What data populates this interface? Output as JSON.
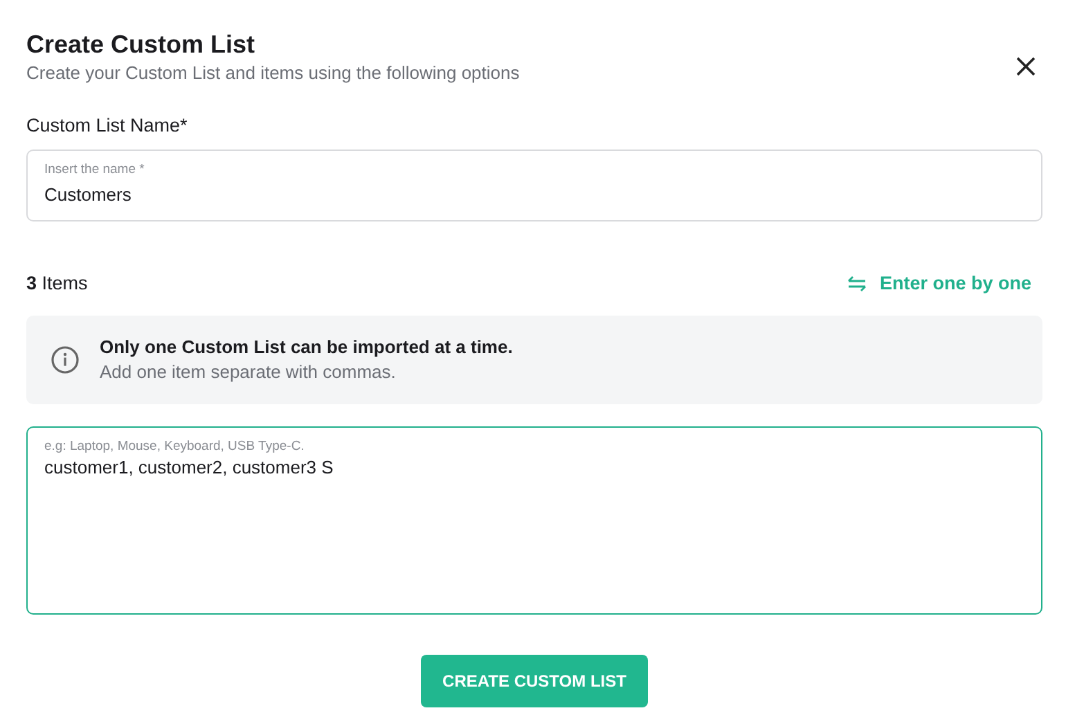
{
  "dialog": {
    "title": "Create Custom List",
    "subtitle": "Create your Custom List and items using the following options"
  },
  "name_field": {
    "label": "Custom List Name*",
    "floating_label": "Insert the name *",
    "value": "Customers",
    "focused": false
  },
  "items": {
    "count_text": "**3** Items",
    "toggle_link": "Enter one by one"
  },
  "info": {
    "title": "Only one Custom List can be imported at a time.",
    "text": "Add one item separate with commas."
  },
  "items_field": {
    "floating_label": "e.g: Laptop, Mouse, Keyboard, USB Type-C.",
    "value": "customer1, customer2, customer3 S",
    "focused": true
  },
  "submit_button": "CREATE CUSTOM LIST"
}
